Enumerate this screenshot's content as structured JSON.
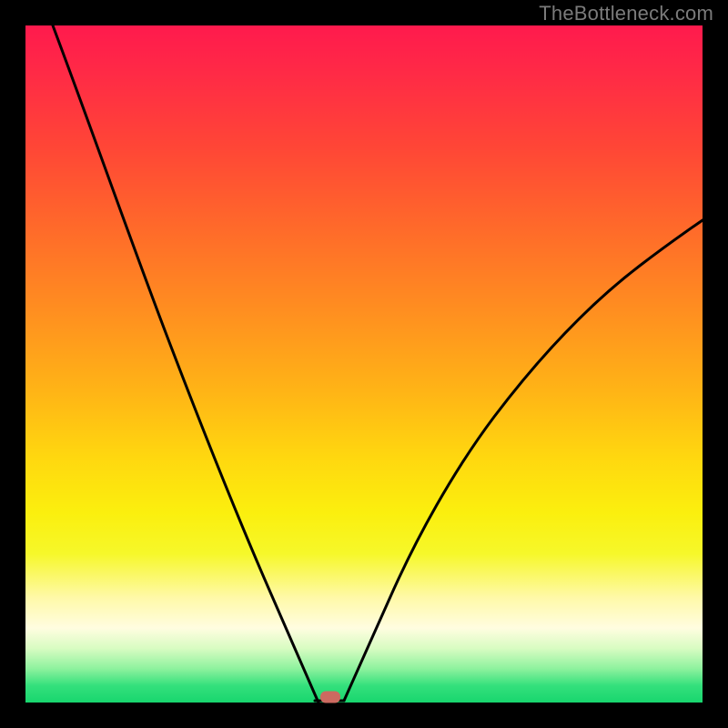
{
  "watermark": "TheBottleneck.com",
  "chart_data": {
    "type": "line",
    "title": "",
    "xlabel": "",
    "ylabel": "",
    "xlim": [
      0,
      100
    ],
    "ylim": [
      0,
      100
    ],
    "grid": false,
    "legend": false,
    "series": [
      {
        "name": "left-branch",
        "x": [
          4,
          8,
          12,
          16,
          20,
          24,
          28,
          32,
          36,
          38,
          40,
          41,
          42,
          43
        ],
        "y": [
          100,
          90,
          80,
          70,
          60,
          51,
          42,
          33,
          22,
          15,
          8,
          4,
          1,
          0
        ]
      },
      {
        "name": "right-branch",
        "x": [
          47,
          49,
          52,
          56,
          60,
          65,
          70,
          76,
          82,
          88,
          94,
          100
        ],
        "y": [
          0,
          4,
          10,
          18,
          26,
          34,
          42,
          49,
          56,
          62,
          67,
          72
        ]
      }
    ],
    "annotations": [
      {
        "name": "optimal-marker",
        "x": 45,
        "y": 0.8,
        "shape": "pill",
        "color": "#cc6a60"
      }
    ],
    "gradient_stops": [
      {
        "pos": 0,
        "color": "#ff1a4d"
      },
      {
        "pos": 42,
        "color": "#ff8e20"
      },
      {
        "pos": 72,
        "color": "#fbef0e"
      },
      {
        "pos": 89,
        "color": "#fffde0"
      },
      {
        "pos": 100,
        "color": "#18d66e"
      }
    ]
  }
}
